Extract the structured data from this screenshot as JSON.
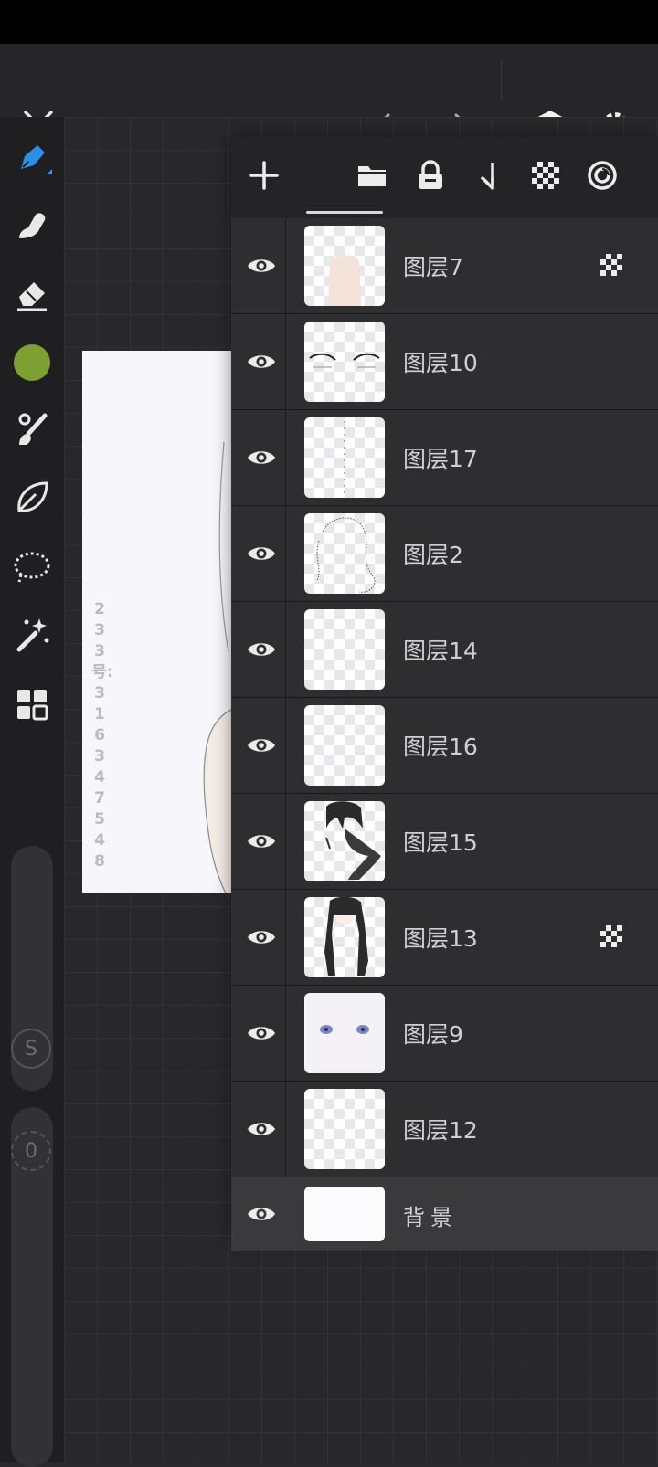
{
  "topbar": {
    "close_icon": "close-icon",
    "undo_icon": "undo-icon",
    "redo_icon": "redo-icon",
    "layers_icon": "layers-icon",
    "settings_icon": "gear-icon"
  },
  "toolbar": {
    "tools": [
      "pen-tool-icon",
      "smudge-tool-icon",
      "eraser-icon",
      "color-swatch",
      "brush-icon",
      "leaf-icon",
      "lasso-icon",
      "magic-wand-icon",
      "grid-icon"
    ],
    "color": "#7ea032",
    "size_slider_label": "S",
    "opacity_slider_label": "0"
  },
  "canvas": {
    "side_text": "233号:316347548"
  },
  "layers_panel": {
    "toolbar_icons": [
      "add-layer-icon",
      "folder-icon",
      "lock-icon",
      "merge-down-icon",
      "checker-icon",
      "blend-icon"
    ],
    "layers": [
      {
        "name": "图层7",
        "badge": true,
        "thumb": "torso"
      },
      {
        "name": "图层10",
        "badge": false,
        "thumb": "eyes-lines"
      },
      {
        "name": "图层17",
        "badge": false,
        "thumb": "dots"
      },
      {
        "name": "图层2",
        "badge": false,
        "thumb": "sketch"
      },
      {
        "name": "图层14",
        "badge": false,
        "thumb": "empty"
      },
      {
        "name": "图层16",
        "badge": false,
        "thumb": "empty"
      },
      {
        "name": "图层15",
        "badge": false,
        "thumb": "hair-front"
      },
      {
        "name": "图层13",
        "badge": true,
        "thumb": "hair-full"
      },
      {
        "name": "图层9",
        "badge": false,
        "thumb": "face"
      },
      {
        "name": "图层12",
        "badge": false,
        "thumb": "empty"
      }
    ],
    "background_layer": {
      "name": "背景"
    }
  }
}
